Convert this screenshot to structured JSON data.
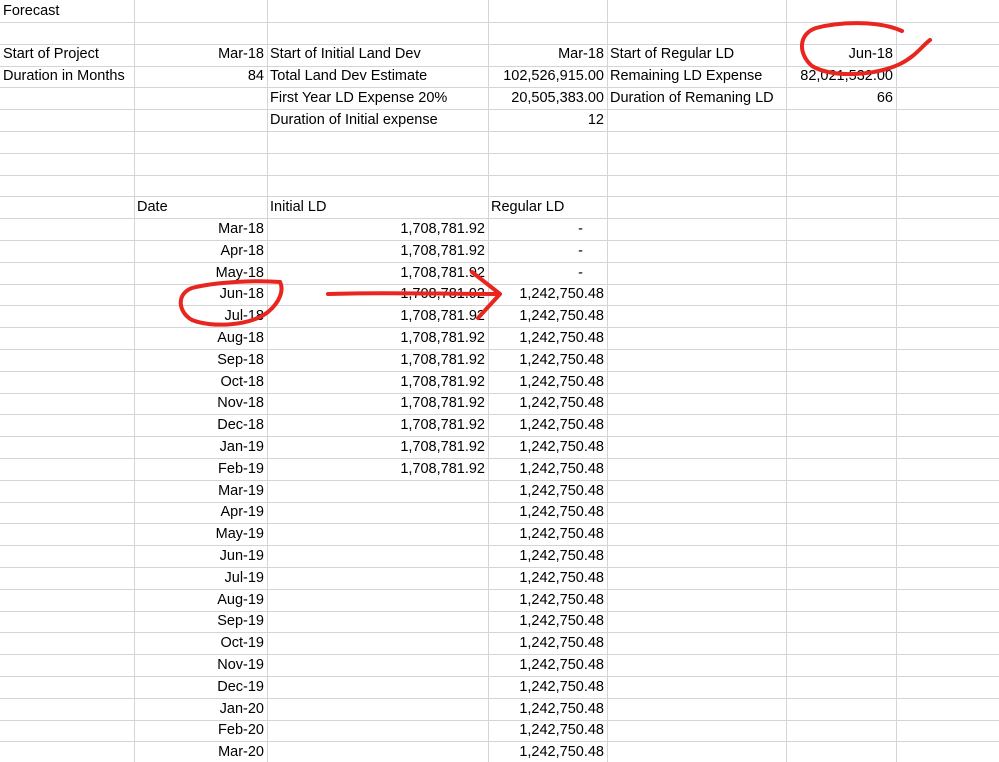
{
  "sheet": {
    "title": "Forecast",
    "summary": {
      "start_project_label": "Start of Project",
      "start_project_value": "Mar-18",
      "duration_label": "Duration in Months",
      "duration_value": "84",
      "start_initial_ld_label": "Start of Initial Land Dev",
      "start_initial_ld_value": "Mar-18",
      "total_ld_label": "Total Land Dev Estimate",
      "total_ld_value": "102,526,915.00",
      "first_year_label": "First Year LD Expense 20%",
      "first_year_value": "20,505,383.00",
      "duration_initial_label": "Duration of Initial expense",
      "duration_initial_value": "12",
      "start_regular_label": "Start of Regular LD",
      "start_regular_value": "Jun-18",
      "remaining_label": "Remaining LD Expense",
      "remaining_value": "82,021,532.00",
      "duration_remaining_label": "Duration of Remaning LD",
      "duration_remaining_value": "66"
    },
    "table": {
      "headers": {
        "date": "Date",
        "initial": "Initial LD",
        "regular": "Regular LD"
      },
      "rows": [
        {
          "date": "Mar-18",
          "initial": "1,708,781.92",
          "regular": "-"
        },
        {
          "date": "Apr-18",
          "initial": "1,708,781.92",
          "regular": "-"
        },
        {
          "date": "May-18",
          "initial": "1,708,781.92",
          "regular": "-"
        },
        {
          "date": "Jun-18",
          "initial": "1,708,781.92",
          "regular": "1,242,750.48"
        },
        {
          "date": "Jul-18",
          "initial": "1,708,781.92",
          "regular": "1,242,750.48"
        },
        {
          "date": "Aug-18",
          "initial": "1,708,781.92",
          "regular": "1,242,750.48"
        },
        {
          "date": "Sep-18",
          "initial": "1,708,781.92",
          "regular": "1,242,750.48"
        },
        {
          "date": "Oct-18",
          "initial": "1,708,781.92",
          "regular": "1,242,750.48"
        },
        {
          "date": "Nov-18",
          "initial": "1,708,781.92",
          "regular": "1,242,750.48"
        },
        {
          "date": "Dec-18",
          "initial": "1,708,781.92",
          "regular": "1,242,750.48"
        },
        {
          "date": "Jan-19",
          "initial": "1,708,781.92",
          "regular": "1,242,750.48"
        },
        {
          "date": "Feb-19",
          "initial": "1,708,781.92",
          "regular": "1,242,750.48"
        },
        {
          "date": "Mar-19",
          "initial": "",
          "regular": "1,242,750.48"
        },
        {
          "date": "Apr-19",
          "initial": "",
          "regular": "1,242,750.48"
        },
        {
          "date": "May-19",
          "initial": "",
          "regular": "1,242,750.48"
        },
        {
          "date": "Jun-19",
          "initial": "",
          "regular": "1,242,750.48"
        },
        {
          "date": "Jul-19",
          "initial": "",
          "regular": "1,242,750.48"
        },
        {
          "date": "Aug-19",
          "initial": "",
          "regular": "1,242,750.48"
        },
        {
          "date": "Sep-19",
          "initial": "",
          "regular": "1,242,750.48"
        },
        {
          "date": "Oct-19",
          "initial": "",
          "regular": "1,242,750.48"
        },
        {
          "date": "Nov-19",
          "initial": "",
          "regular": "1,242,750.48"
        },
        {
          "date": "Dec-19",
          "initial": "",
          "regular": "1,242,750.48"
        },
        {
          "date": "Jan-20",
          "initial": "",
          "regular": "1,242,750.48"
        },
        {
          "date": "Feb-20",
          "initial": "",
          "regular": "1,242,750.48"
        },
        {
          "date": "Mar-20",
          "initial": "",
          "regular": "1,242,750.48"
        }
      ]
    },
    "annotation_color": "#e8251f"
  }
}
